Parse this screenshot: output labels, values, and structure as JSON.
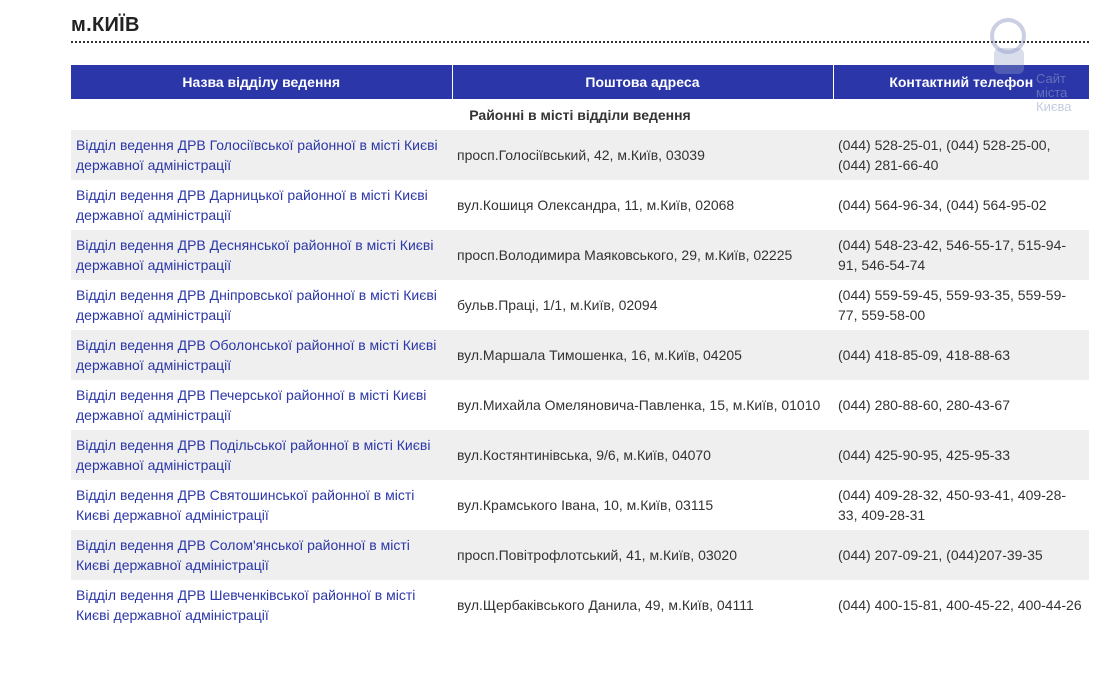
{
  "page": {
    "title": "м.КИЇВ"
  },
  "watermark": {
    "text": "Сайт міста Києва"
  },
  "table": {
    "headers": [
      "Назва відділу ведення",
      "Поштова адреса",
      "Контактний телефон"
    ],
    "section_label": "Районні в місті відділи ведення",
    "rows": [
      {
        "name": "Відділ ведення ДРВ Голосіївської районної в місті Києві державної адміністрації",
        "address": "просп.Голосіївський, 42, м.Київ, 03039",
        "phone": "(044) 528-25-01, (044) 528-25-00, (044) 281-66-40"
      },
      {
        "name": "Відділ ведення ДРВ Дарницької районної в місті Києві державної адміністрації",
        "address": "вул.Кошиця Олександра, 11, м.Київ, 02068",
        "phone": "(044) 564-96-34, (044) 564-95-02"
      },
      {
        "name": "Відділ ведення ДРВ Деснянської районної в місті Києві державної адміністрації",
        "address": "просп.Володимира Маяковського, 29, м.Київ, 02225",
        "phone": "(044) 548-23-42, 546-55-17, 515-94-91, 546-54-74"
      },
      {
        "name": "Відділ ведення ДРВ Дніпровської районної в місті Києві державної адміністрації",
        "address": "бульв.Праці, 1/1, м.Київ, 02094",
        "phone": "(044) 559-59-45, 559-93-35, 559-59-77, 559-58-00"
      },
      {
        "name": "Відділ ведення ДРВ Оболонської районної в місті Києві державної адміністрації",
        "address": "вул.Маршала Тимошенка, 16, м.Київ, 04205",
        "phone": "(044) 418-85-09, 418-88-63"
      },
      {
        "name": "Відділ ведення ДРВ Печерської районної в місті Києві державної адміністрації",
        "address": "вул.Михайла Омеляновича-Павленка, 15, м.Київ, 01010",
        "phone": "(044) 280-88-60, 280-43-67"
      },
      {
        "name": "Відділ ведення ДРВ Подільської районної в місті Києві державної адміністрації",
        "address": "вул.Костянтинівська, 9/6, м.Київ, 04070",
        "phone": "(044) 425-90-95, 425-95-33"
      },
      {
        "name": "Відділ ведення ДРВ Святошинської районної в місті Києві державної адміністрації",
        "address": "вул.Крамського Івана, 10, м.Київ, 03115",
        "phone": "(044) 409-28-32, 450-93-41, 409-28-33, 409-28-31"
      },
      {
        "name": "Відділ ведення ДРВ Солом'янської районної в місті Києві державної адміністрації",
        "address": "просп.Повітрофлотський, 41, м.Київ, 03020",
        "phone": "(044) 207-09-21, (044)207-39-35"
      },
      {
        "name": "Відділ ведення ДРВ Шевченківської районної в місті Києві державної адміністрації",
        "address": "вул.Щербаківського Данила, 49, м.Київ, 04111",
        "phone": "(044) 400-15-81, 400-45-22, 400-44-26"
      }
    ]
  }
}
